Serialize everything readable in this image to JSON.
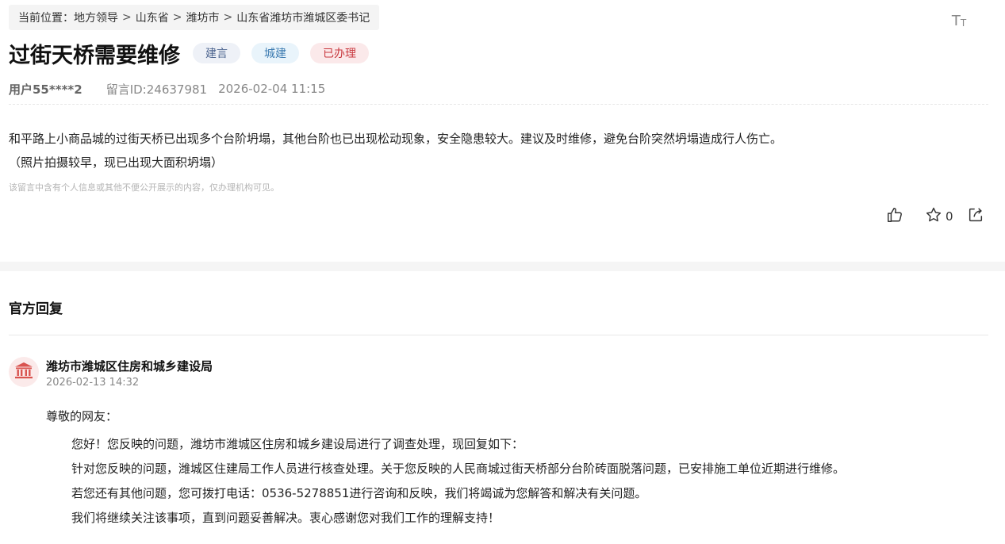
{
  "breadcrumb": {
    "prefix": "当前位置：",
    "items": [
      "地方领导",
      "山东省",
      "潍坊市",
      "山东省潍坊市潍城区委书记"
    ],
    "separator": ">"
  },
  "font_size_toggle": {
    "big": "T",
    "small": "T"
  },
  "post": {
    "title": "过街天桥需要维修",
    "tags": [
      {
        "label": "建言"
      },
      {
        "label": "城建"
      },
      {
        "label": "已办理"
      }
    ],
    "user": "用户55****2",
    "message_id": "留言ID:24637981",
    "datetime": "2026-02-04 11:15",
    "content_line1": "和平路上小商品城的过街天桥已出现多个台阶坍塌，其他台阶也已出现松动现象，安全隐患较大。建议及时维修，避免台阶突然坍塌造成行人伤亡。",
    "content_line2": "（照片拍摄较早，现已出现大面积坍塌）",
    "privacy_note": "该留言中含有个人信息或其他不便公开展示的内容，仅办理机构可见。",
    "favorite_count": "0"
  },
  "reply": {
    "section_title": "官方回复",
    "org_name": "潍坊市潍城区住房和城乡建设局",
    "org_time": "2026-02-13 14:32",
    "greeting": "尊敬的网友：",
    "paragraphs": [
      "您好！您反映的问题，潍坊市潍城区住房和城乡建设局进行了调查处理，现回复如下：",
      "针对您反映的问题，潍城区住建局工作人员进行核查处理。关于您反映的人民商城过街天桥部分台阶砖面脱落问题，已安排施工单位近期进行维修。",
      "若您还有其他问题，您可拨打电话：0536-5278851进行咨询和反映，我们将竭诚为您解答和解决有关问题。",
      "我们将继续关注该事项，直到问题妥善解决。衷心感谢您对我们工作的理解支持！"
    ]
  },
  "colors": {
    "tag_suggestion": "#4e6690",
    "tag_urban": "#3f7db2",
    "tag_done": "#c8383e",
    "org_icon": "#d9534f"
  },
  "icons": {
    "like": "thumbs-up-icon",
    "favorite": "star-icon",
    "share": "share-icon",
    "org": "government-building-icon"
  }
}
